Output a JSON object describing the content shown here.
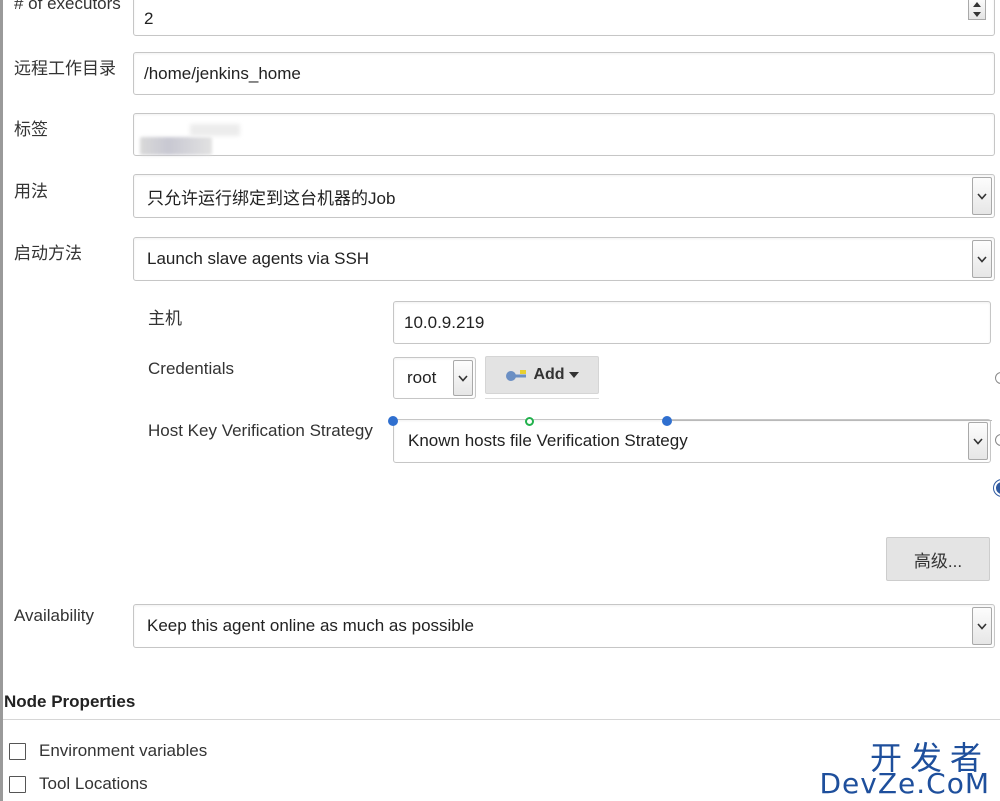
{
  "form": {
    "executors": {
      "label": "# of executors",
      "value": "2"
    },
    "remote_dir": {
      "label": "远程工作目录",
      "value": "/home/jenkins_home"
    },
    "labels": {
      "label": "标签",
      "value": ""
    },
    "usage": {
      "label": "用法",
      "value": "只允许运行绑定到这台机器的Job"
    },
    "launch": {
      "label": "启动方法",
      "value": "Launch slave agents via SSH"
    },
    "host": {
      "label": "主机",
      "value": "10.0.9.219"
    },
    "credentials": {
      "label": "Credentials",
      "value": "root",
      "add_label": "Add"
    },
    "host_key": {
      "label": "Host Key Verification Strategy",
      "value": "Known hosts file Verification Strategy"
    },
    "advanced_label": "高级...",
    "availability": {
      "label": "Availability",
      "value": "Keep this agent online as much as possible"
    }
  },
  "node_properties": {
    "title": "Node Properties",
    "items": [
      {
        "label": "Environment variables",
        "checked": false
      },
      {
        "label": "Tool Locations",
        "checked": false
      }
    ]
  },
  "watermark": {
    "cn": "开发者",
    "en": "DevZe.CoM"
  },
  "icons": {
    "caret": "chevron-down-icon",
    "spinner": "spinner-icon",
    "key": "key-icon",
    "help": "help-icon"
  },
  "colors": {
    "watermark": "#1e4f9c",
    "dot_blue": "#2f6fcf",
    "dot_green": "#22b14c"
  }
}
